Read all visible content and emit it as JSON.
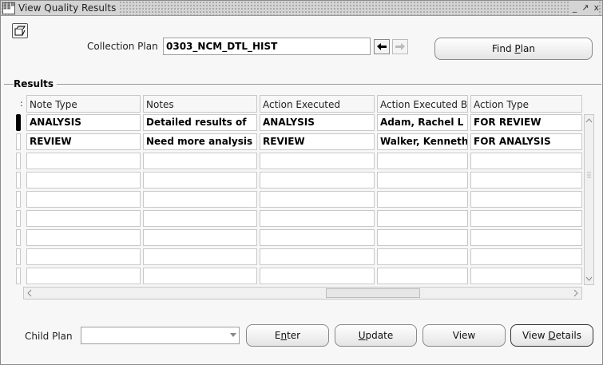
{
  "window": {
    "title": "View Quality Results",
    "controls": [
      "_",
      "↗",
      "x"
    ]
  },
  "collection_plan": {
    "label": "Collection Plan",
    "value": "0303_NCM_DTL_HIST"
  },
  "find_plan_button": {
    "label_pre": "Find ",
    "label_key": "P",
    "label_post": "lan"
  },
  "results": {
    "label": "Results",
    "columns": [
      "Note Type",
      "Notes",
      "Action Executed",
      "Action Executed B",
      "Action Type"
    ],
    "rows": [
      [
        "ANALYSIS",
        "Detailed results of",
        "ANALYSIS",
        "Adam, Rachel L",
        "FOR REVIEW"
      ],
      [
        "REVIEW",
        "Need more analysis",
        "REVIEW",
        "Walker, Kenneth",
        "FOR ANALYSIS"
      ],
      [
        "",
        "",
        "",
        "",
        ""
      ],
      [
        "",
        "",
        "",
        "",
        ""
      ],
      [
        "",
        "",
        "",
        "",
        ""
      ],
      [
        "",
        "",
        "",
        "",
        ""
      ],
      [
        "",
        "",
        "",
        "",
        ""
      ],
      [
        "",
        "",
        "",
        "",
        ""
      ],
      [
        "",
        "",
        "",
        "",
        ""
      ]
    ]
  },
  "child_plan": {
    "label": "Child Plan",
    "value": ""
  },
  "buttons": {
    "enter": {
      "pre": "E",
      "key": "n",
      "post": "ter"
    },
    "update": {
      "pre": "",
      "key": "U",
      "post": "pdate"
    },
    "view": {
      "pre": "View",
      "key": "",
      "post": ""
    },
    "view_details": {
      "pre": "View ",
      "key": "D",
      "post": "etails"
    }
  }
}
